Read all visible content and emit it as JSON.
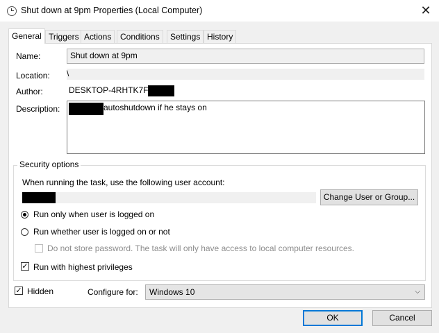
{
  "window": {
    "title": "Shut down at 9pm Properties (Local Computer)",
    "close_glyph": "✕"
  },
  "tabs": [
    {
      "label": "General"
    },
    {
      "label": "Triggers"
    },
    {
      "label": "Actions"
    },
    {
      "label": "Conditions"
    },
    {
      "label": "Settings"
    },
    {
      "label": "History"
    }
  ],
  "general": {
    "name_label": "Name:",
    "name_value": "Shut down at 9pm",
    "location_label": "Location:",
    "location_value": "\\",
    "author_label": "Author:",
    "author_value": "DESKTOP-4RHTK7F",
    "description_label": "Description:",
    "description_value": "autoshutdown if he stays on"
  },
  "security": {
    "group_title": "Security options",
    "account_prompt": "When running the task, use the following user account:",
    "change_user_button": "Change User or Group...",
    "radio_logged_on": "Run only when user is logged on",
    "radio_whether": "Run whether user is logged on or not",
    "store_password": "Do not store password.  The task will only have access to local computer resources.",
    "highest_privileges": "Run with highest privileges"
  },
  "bottom": {
    "hidden_label": "Hidden",
    "configure_label": "Configure for:",
    "configure_value": "Windows 10"
  },
  "buttons": {
    "ok": "OK",
    "cancel": "Cancel"
  }
}
